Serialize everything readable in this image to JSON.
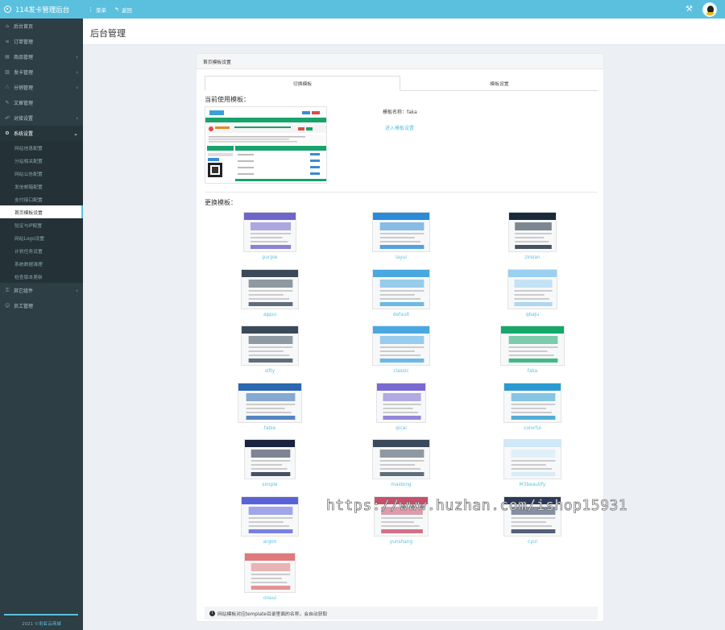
{
  "app": {
    "title": "114发卡管理后台"
  },
  "topnav": {
    "home_label": "菜单",
    "back_label": "返回"
  },
  "sidebar": {
    "items": [
      {
        "label": "后台首页",
        "icon": "home-icon",
        "glyph": "⌂"
      },
      {
        "label": "订单管理",
        "icon": "list-icon",
        "glyph": "≡"
      },
      {
        "label": "商品管理",
        "icon": "shop-icon",
        "glyph": "▤",
        "chevron": "‹"
      },
      {
        "label": "发卡管理",
        "icon": "card-icon",
        "glyph": "▥",
        "chevron": "‹"
      },
      {
        "label": "分销管理",
        "icon": "share-icon",
        "glyph": "ஃ",
        "chevron": "‹"
      },
      {
        "label": "文章管理",
        "icon": "edit-icon",
        "glyph": "✎"
      },
      {
        "label": "对接设置",
        "icon": "link-icon",
        "glyph": "☍",
        "chevron": "‹"
      },
      {
        "label": "系统设置",
        "icon": "gear-icon",
        "glyph": "⚙",
        "chevron": "⌄"
      }
    ],
    "sub_items": [
      "网站信息配置",
      "分站相关配置",
      "网站公告配置",
      "发信邮箱配置",
      "支付接口配置",
      "首页模板设置",
      "验证与IP配置",
      "网站Logo设置",
      "计划任务设置",
      "系统数据清理",
      "检查版本更新"
    ],
    "after_items": [
      {
        "label": "其它组件",
        "icon": "plugin-icon",
        "glyph": "⚿",
        "chevron": "‹"
      },
      {
        "label": "员工管理",
        "icon": "user-icon",
        "glyph": "☺"
      }
    ],
    "footer_year": "2021 ©",
    "footer_brand": "彩虹云商城"
  },
  "page": {
    "title": "后台管理"
  },
  "panel": {
    "title": "首页模板设置",
    "tab_switch": "切换模板",
    "tab_settings": "模板设置",
    "current_label": "当前使用模板：",
    "current_name": "模板名称：faka",
    "enter_settings": "进入模板设置",
    "change_label": "更换模板：",
    "note": "网站模板对应template目录里面的名称，会自动获取"
  },
  "templates": [
    {
      "name": "purple",
      "color": "#6f64c8"
    },
    {
      "name": "layui",
      "color": "#2c8ad6"
    },
    {
      "name": "zirelan",
      "color": "#1a2a3a"
    },
    {
      "name": "appui",
      "color": "#3a4a5a"
    },
    {
      "name": "default",
      "color": "#4aa8e0"
    },
    {
      "name": "qbaju",
      "color": "#9ad0f0"
    },
    {
      "name": "sifty",
      "color": "#3a4a5a"
    },
    {
      "name": "classic",
      "color": "#4aa8e0"
    },
    {
      "name": "faka",
      "color": "#16a86a"
    },
    {
      "name": "fable",
      "color": "#2a68b0"
    },
    {
      "name": "qicai",
      "color": "#7a6ad0"
    },
    {
      "name": "colorful",
      "color": "#2a9ad0"
    },
    {
      "name": "simple",
      "color": "#1a2440"
    },
    {
      "name": "maidong",
      "color": "#3a4a5a"
    },
    {
      "name": "M3beautify",
      "color": "#d0e8f8"
    },
    {
      "name": "argon",
      "color": "#5a62d8"
    },
    {
      "name": "yunshang",
      "color": "#c8506a"
    },
    {
      "name": "cyui",
      "color": "#2a3a5a"
    },
    {
      "name": "oneui",
      "color": "#e07a7a"
    }
  ],
  "watermark": "https://www.huzhan.com/ishop15931"
}
